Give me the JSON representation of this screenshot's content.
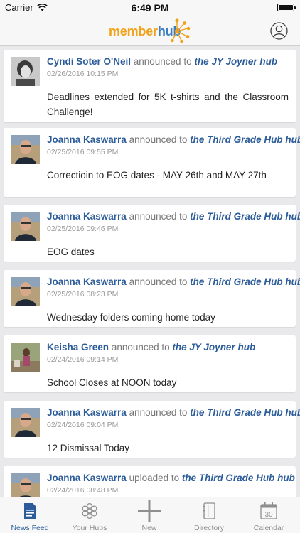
{
  "status_bar": {
    "carrier": "Carrier",
    "time": "6:49 PM"
  },
  "header": {
    "logo_part1": "member",
    "logo_part2": "hub",
    "colors": {
      "logo_orange": "#f2a21a",
      "logo_blue": "#3a7ec1"
    }
  },
  "feed": [
    {
      "author": "Cyndi Soter O'Neil",
      "action": "announced to",
      "hub": "the JY Joyner hub",
      "date": "02/26/2016 10:15 PM",
      "text": "Deadlines extended for 5K t-shirts and the Classroom Challenge!"
    },
    {
      "author": "Joanna Kaswarra",
      "action": "announced to",
      "hub": "the Third Grade Hub hub",
      "date": "02/25/2016 09:55 PM",
      "text": "Correctioin to EOG dates - MAY 26th and MAY 27th"
    },
    {
      "author": "Joanna Kaswarra",
      "action": "announced to",
      "hub": "the Third Grade Hub hub",
      "date": "02/25/2016 09:46 PM",
      "text": "EOG dates"
    },
    {
      "author": "Joanna Kaswarra",
      "action": "announced to",
      "hub": "the Third Grade Hub hub",
      "date": "02/25/2016 08:23 PM",
      "text": "Wednesday folders coming home today"
    },
    {
      "author": "Keisha Green",
      "action": "announced to",
      "hub": "the JY Joyner hub",
      "date": "02/24/2016 09:14 PM",
      "text": "School Closes at NOON today"
    },
    {
      "author": "Joanna Kaswarra",
      "action": "announced to",
      "hub": "the Third Grade Hub hub",
      "date": "02/24/2016 09:04 PM",
      "text": "12 Dismissal Today"
    },
    {
      "author": "Joanna Kaswarra",
      "action": "uploaded to",
      "hub": "the Third Grade Hub hub",
      "date": "02/24/2016 08:48 PM",
      "text": ""
    }
  ],
  "tabs": [
    {
      "label": "News Feed",
      "icon": "news-feed-icon",
      "active": true
    },
    {
      "label": "Your Hubs",
      "icon": "hubs-icon",
      "active": false
    },
    {
      "label": "New",
      "icon": "plus-icon",
      "active": false
    },
    {
      "label": "Directory",
      "icon": "directory-icon",
      "active": false
    },
    {
      "label": "Calendar",
      "icon": "calendar-icon",
      "active": false
    }
  ],
  "calendar_icon_day": "30",
  "colors": {
    "link_blue": "#2c5d9a",
    "tab_inactive": "#8e8e8e",
    "background": "#e9e9eb"
  }
}
